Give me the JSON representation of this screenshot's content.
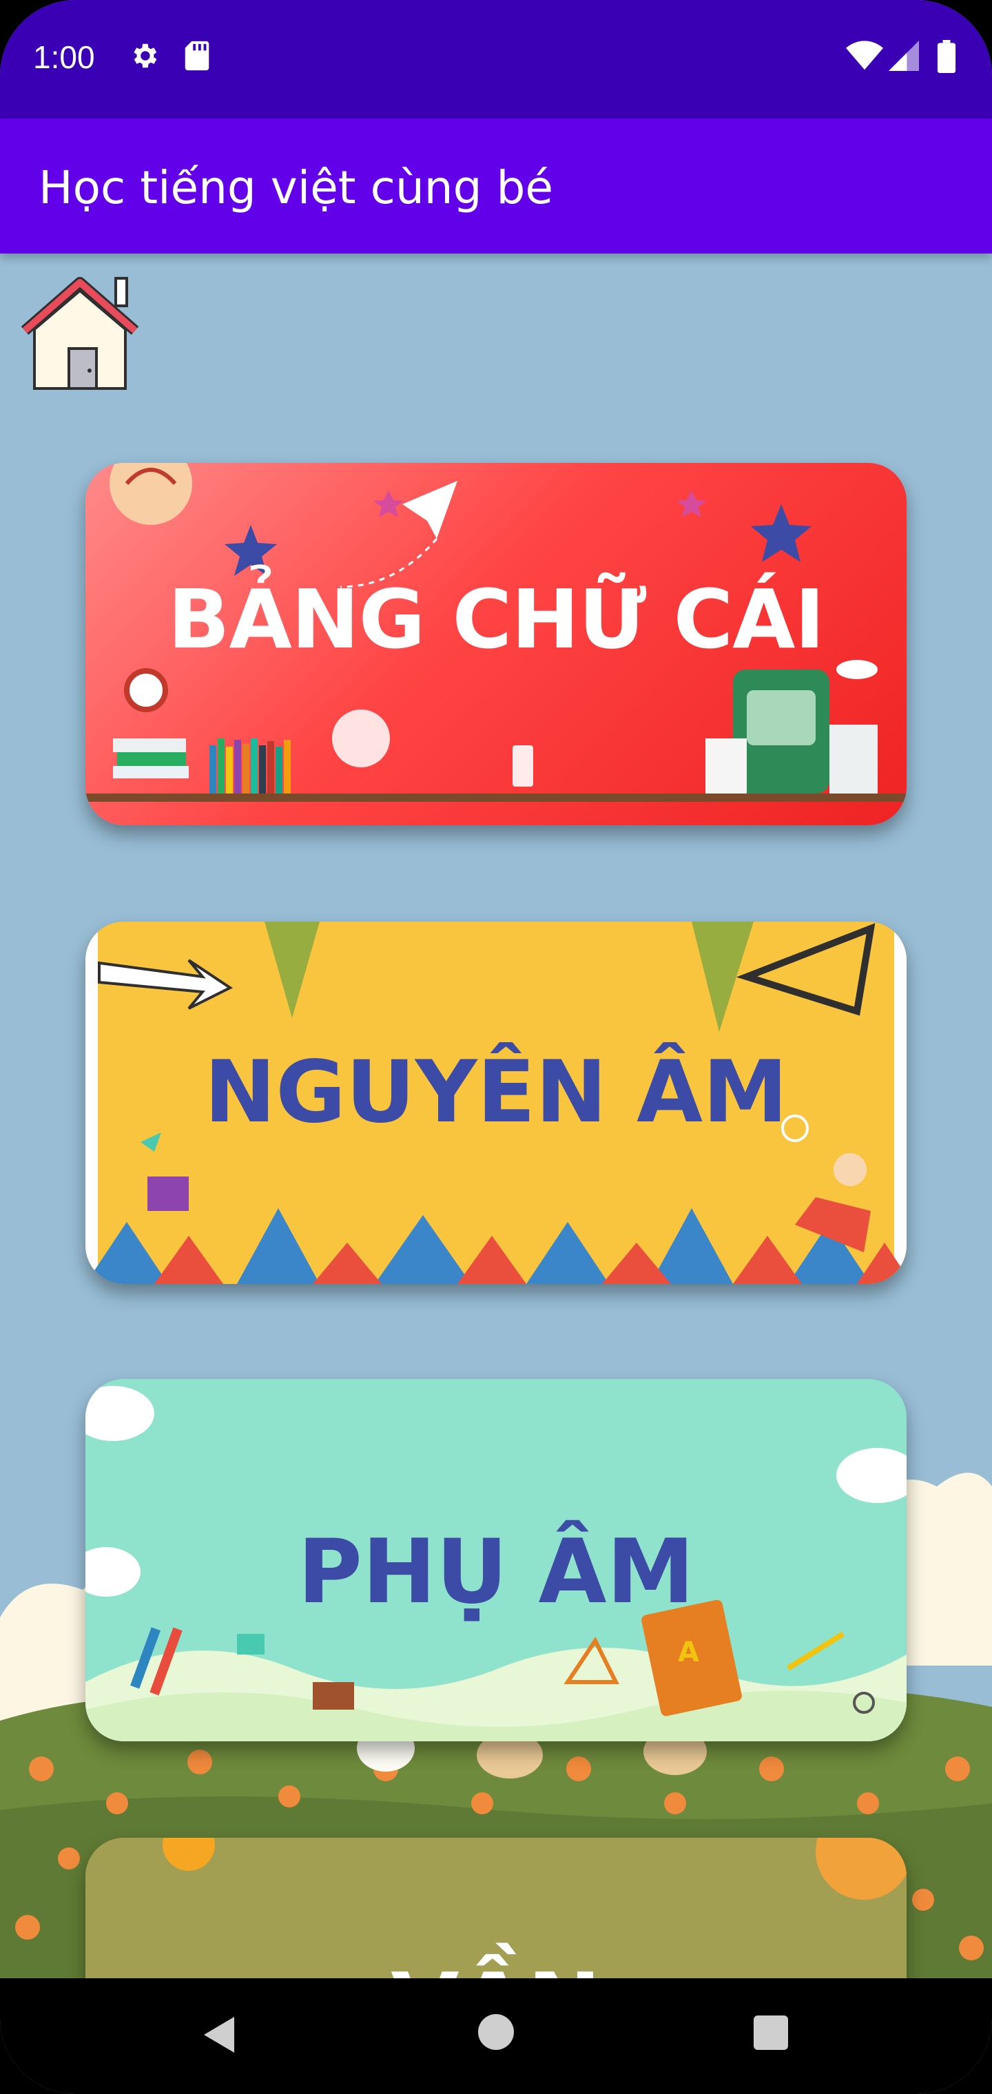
{
  "status_bar": {
    "time": "1:00",
    "icons": [
      "settings-icon",
      "sd-card-icon",
      "wifi-icon",
      "signal-icon",
      "battery-icon"
    ]
  },
  "app_bar": {
    "title": "Học tiếng việt cùng bé"
  },
  "home_button": {
    "icon": "home-icon"
  },
  "cards": [
    {
      "label": "BẢNG CHỮ CÁI"
    },
    {
      "label": "NGUYÊN ÂM"
    },
    {
      "label": "PHỤ ÂM"
    },
    {
      "label": "VẦN"
    }
  ],
  "nav_bar": {
    "icons": [
      "back-icon",
      "home-circle-icon",
      "recents-icon"
    ]
  },
  "colors": {
    "status_bar": "#3a00b4",
    "app_bar": "#6200ea",
    "background": "#98bdd5",
    "card1": "#f44444",
    "card2": "#f9c53f",
    "card3": "#8fe2cb",
    "card4": "#a39f52",
    "label_blue": "#3b4ba6"
  }
}
